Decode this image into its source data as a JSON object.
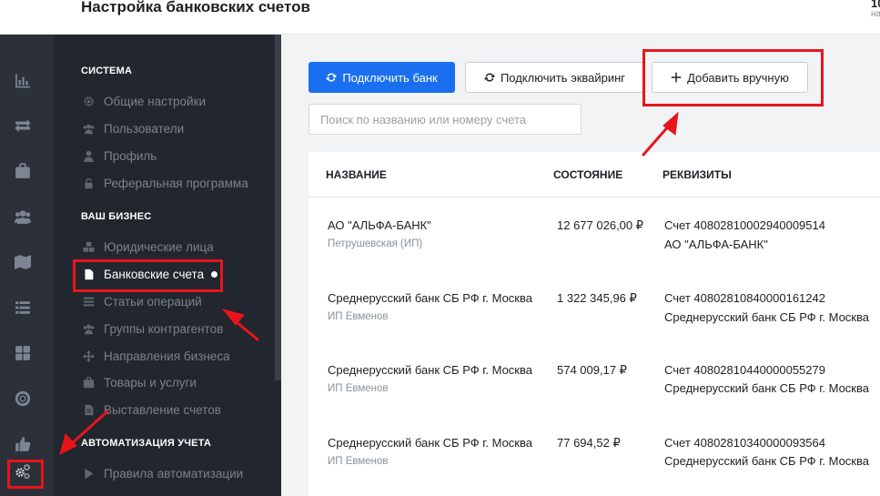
{
  "header": {
    "title": "Настройка банковских счетов",
    "corner_number": "10",
    "corner_sub": "на"
  },
  "rail": {
    "icons": [
      "chart-icon",
      "transfer-icon",
      "briefcase-icon",
      "users-icon",
      "map-icon",
      "list-icon",
      "dashboard-icon",
      "lifebuoy-icon",
      "thumbs-up-icon",
      "gears-icon"
    ]
  },
  "sidebar": {
    "sections": [
      {
        "heading": "СИСТЕМА",
        "items": [
          {
            "label": "Общие настройки",
            "icon": "gear-icon"
          },
          {
            "label": "Пользователи",
            "icon": "users-icon"
          },
          {
            "label": "Профиль",
            "icon": "user-icon"
          },
          {
            "label": "Реферальная программа",
            "icon": "lock-icon"
          }
        ]
      },
      {
        "heading": "ВАШ БИЗНЕС",
        "items": [
          {
            "label": "Юридические лица",
            "icon": "cubes-icon"
          },
          {
            "label": "Банковские счета",
            "icon": "file-icon",
            "active": true
          },
          {
            "label": "Статьи операций",
            "icon": "list-icon"
          },
          {
            "label": "Группы контрагентов",
            "icon": "users-icon"
          },
          {
            "label": "Направления бизнеса",
            "icon": "arrows-icon"
          },
          {
            "label": "Товары и услуги",
            "icon": "briefcase-icon"
          },
          {
            "label": "Выставление счетов",
            "icon": "invoice-icon"
          }
        ]
      },
      {
        "heading": "АВТОМАТИЗАЦИЯ УЧЕТА",
        "items": [
          {
            "label": "Правила автоматизации",
            "icon": "play-icon"
          }
        ]
      }
    ]
  },
  "toolbar": {
    "connect_bank": "Подключить банк",
    "connect_acquiring": "Подключить эквайринг",
    "add_manual": "Добавить вручную"
  },
  "search": {
    "placeholder": "Поиск по названию или номеру счета",
    "value": ""
  },
  "table": {
    "columns": [
      "НАЗВАНИЕ",
      "СОСТОЯНИЕ",
      "РЕКВИЗИТЫ"
    ],
    "rows": [
      {
        "name": "АО \"АЛЬФА-БАНК\"",
        "owner": "Петрушевская (ИП)",
        "balance": "12 677 026,00 ₽",
        "account": "Счет 40802810002940009514",
        "bank": "АО \"АЛЬФА-БАНК\""
      },
      {
        "name": "Среднерусский банк СБ РФ г. Москва",
        "owner": "ИП Евменов",
        "balance": "1 322 345,96 ₽",
        "account": "Счет 40802810840000161242",
        "bank": "Среднерусский банк СБ РФ г. Москва"
      },
      {
        "name": "Среднерусский банк СБ РФ г. Москва",
        "owner": "ИП Евменов",
        "balance": "574 009,17 ₽",
        "account": "Счет 40802810440000055279",
        "bank": "Среднерусский банк СБ РФ г. Москва"
      },
      {
        "name": "Среднерусский банк СБ РФ г. Москва",
        "owner": "ИП Евменов",
        "balance": "77 694,52 ₽",
        "account": "Счет 40802810340000093564",
        "bank": "Среднерусский банк СБ РФ г. Москва"
      }
    ]
  },
  "colors": {
    "primary": "#1a6ff0",
    "rail_bg": "#2b3039",
    "sidebar_bg": "#22262e",
    "annotation_red": "#e8141c"
  }
}
